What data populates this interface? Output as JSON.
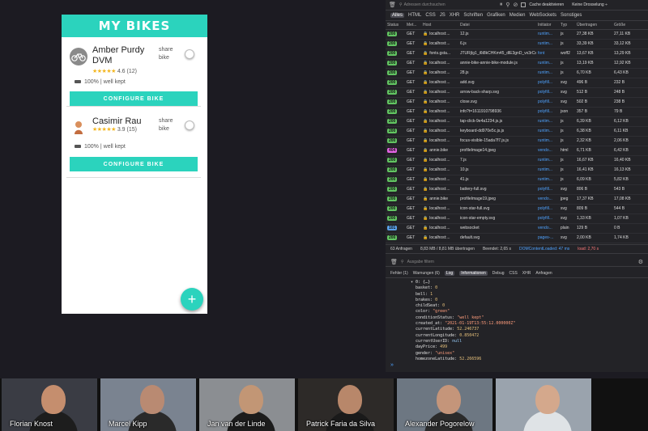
{
  "app": {
    "header_title": "MY BIKES",
    "fab_label": "+",
    "bikes": [
      {
        "name": "Amber Purdy DVM",
        "stars": "★★★★★",
        "rating": "4.6 (12)",
        "share": "share bike",
        "battery": "100%",
        "separator": "|",
        "condition": "well kept",
        "button": "CONFIGURE BIKE"
      },
      {
        "name": "Casimir Rau",
        "stars": "★★★★★",
        "rating": "3.9 (15)",
        "share": "share bike",
        "battery": "100%",
        "separator": "|",
        "condition": "well kept",
        "button": "CONFIGURE BIKE"
      }
    ]
  },
  "devtools": {
    "filter_placeholder": "Adressen durchsuchen",
    "cache_label": "Cache deaktivieren",
    "throttle_label": "Keine Drosselung ÷",
    "type_filters": [
      "Alles",
      "HTML",
      "CSS",
      "JS",
      "XHR",
      "Schriften",
      "Grafiken",
      "Medien",
      "WebSockets",
      "Sonstiges"
    ],
    "columns": [
      "Status",
      "Met...",
      "Host",
      "Datei",
      "Initiator",
      "Typ",
      "Übertragen",
      "Größe"
    ],
    "rows": [
      [
        "200",
        "GET",
        "localhost:...",
        "12.js",
        "runtim...",
        "js",
        "27,38 KB",
        "27,11 KB"
      ],
      [
        "200",
        "GET",
        "localhost:...",
        "6.js",
        "runtim...",
        "js",
        "33,39 KB",
        "33,12 KB"
      ],
      [
        "200",
        "GET",
        "fonts.gsta...",
        "JTURjIg1_i6t8kCHKm45_dlE3gnD_vx3rCs.woff2",
        "font",
        "woff2",
        "13,67 KB",
        "13,29 KB"
      ],
      [
        "200",
        "GET",
        "localhost:...",
        "annie-bike-annie-bike-module.js",
        "runtim...",
        "js",
        "13,19 KB",
        "12,92 KB"
      ],
      [
        "200",
        "GET",
        "localhost:...",
        "28.js",
        "runtim...",
        "js",
        "6,70 KB",
        "6,43 KB"
      ],
      [
        "200",
        "GET",
        "localhost:...",
        "add.svg",
        "polyfill...",
        "svg",
        "496 B",
        "232 B"
      ],
      [
        "200",
        "GET",
        "localhost:...",
        "arrow-back-sharp.svg",
        "polyfill...",
        "svg",
        "512 B",
        "248 B"
      ],
      [
        "200",
        "GET",
        "localhost:...",
        "close.svg",
        "polyfill...",
        "svg",
        "502 B",
        "238 B"
      ],
      [
        "200",
        "GET",
        "localhost:...",
        "info?t=1611910798936",
        "polyfill...",
        "json",
        "357 B",
        "79 B"
      ],
      [
        "200",
        "GET",
        "localhost:...",
        "tap-click-9e4a1234.js.js",
        "runtim...",
        "js",
        "6,39 KB",
        "6,12 KB"
      ],
      [
        "200",
        "GET",
        "localhost:...",
        "keyboard-dd970e5c.js.js",
        "runtim...",
        "js",
        "6,38 KB",
        "6,11 KB"
      ],
      [
        "200",
        "GET",
        "localhost:...",
        "focus-visible-15ada7f7.js.js",
        "runtim...",
        "js",
        "2,32 KB",
        "2,06 KB"
      ],
      [
        "404",
        "GET",
        "annie.bike",
        "profileImage14.jpeg",
        "vendo...",
        "html",
        "6,71 KB",
        "6,42 KB"
      ],
      [
        "200",
        "GET",
        "localhost:...",
        "7.js",
        "runtim...",
        "js",
        "16,67 KB",
        "16,40 KB"
      ],
      [
        "200",
        "GET",
        "localhost:...",
        "10.js",
        "runtim...",
        "js",
        "16,41 KB",
        "16,13 KB"
      ],
      [
        "200",
        "GET",
        "localhost:...",
        "41.js",
        "runtim...",
        "js",
        "6,09 KB",
        "5,82 KB"
      ],
      [
        "200",
        "GET",
        "localhost:...",
        "battery-full.svg",
        "polyfill...",
        "svg",
        "806 B",
        "543 B"
      ],
      [
        "200",
        "GET",
        "annie.bike",
        "profileImage19.jpeg",
        "vendo...",
        "jpeg",
        "17,37 KB",
        "17,08 KB"
      ],
      [
        "200",
        "GET",
        "localhost:...",
        "icon-star-full.svg",
        "polyfill...",
        "svg",
        "809 B",
        "544 B"
      ],
      [
        "200",
        "GET",
        "localhost:...",
        "icon-star-empty.svg",
        "polyfill...",
        "svg",
        "1,33 KB",
        "1,07 KB"
      ],
      [
        "101",
        "GET",
        "localhost:...",
        "websocket",
        "vendo...",
        "plain",
        "129 B",
        "0 B"
      ],
      [
        "200",
        "GET",
        "localhost:...",
        "default.svg",
        "pages-...",
        "svg",
        "2,00 KB",
        "1,74 KB"
      ]
    ],
    "status_requests": "63 Anfragen",
    "status_transfer": "8,83 MB / 8,81 MB übertragen",
    "status_finished": "Beendet: 2,65 s",
    "status_dom": "DOMContentLoaded: 47 ms",
    "status_load": "load: 2,70 s",
    "console_filter": "Ausgabe filtern",
    "console_tabs": [
      "Fehler (1)",
      "Warnungen (6)",
      "Log",
      "Informationen",
      "Debug",
      "CSS",
      "XHR",
      "Anfragen"
    ],
    "console_lines": [
      [
        "▾ 0: {…}",
        ""
      ],
      [
        "basket: ",
        "0"
      ],
      [
        "bell: ",
        "1"
      ],
      [
        "brakes: ",
        "0"
      ],
      [
        "childSeat: ",
        "0"
      ],
      [
        "color: ",
        "\"green\""
      ],
      [
        "conditionStatus: ",
        "\"well kept\""
      ],
      [
        "created_at: ",
        "\"2021-01-19T13:55:12.000000Z\""
      ],
      [
        "currentLatitude: ",
        "52.246737"
      ],
      [
        "currentLongitude: ",
        "0.850472"
      ],
      [
        "currentUserID: ",
        "null"
      ],
      [
        "dayPrice: ",
        "499"
      ],
      [
        "gender: ",
        "\"unisex\""
      ],
      [
        "homezoneLatitude: ",
        "52.266596"
      ]
    ],
    "prompt": "»"
  },
  "participants": [
    {
      "name": "Florian Knost",
      "bg": "#3a3c44",
      "shirt": "#1d1d1d",
      "skin": "#c58e6e"
    },
    {
      "name": "Marcel Kipp",
      "bg": "#7a8390",
      "shirt": "#2a2a2a",
      "skin": "#b98a72"
    },
    {
      "name": "Jan van der Linde",
      "bg": "#8b8e92",
      "shirt": "#1c1c1c",
      "skin": "#c29675"
    },
    {
      "name": "Patrick Faria da Silva",
      "bg": "#2d2a28",
      "shirt": "#1a1a1a",
      "skin": "#b8876a"
    },
    {
      "name": "Alexander Pogorelow",
      "bg": "#6d7782",
      "shirt": "#2b2b2b",
      "skin": "#c4957a"
    },
    {
      "name": "",
      "bg": "#9aa3ad",
      "shirt": "#dfe3e6",
      "skin": "#d4a88c"
    }
  ]
}
